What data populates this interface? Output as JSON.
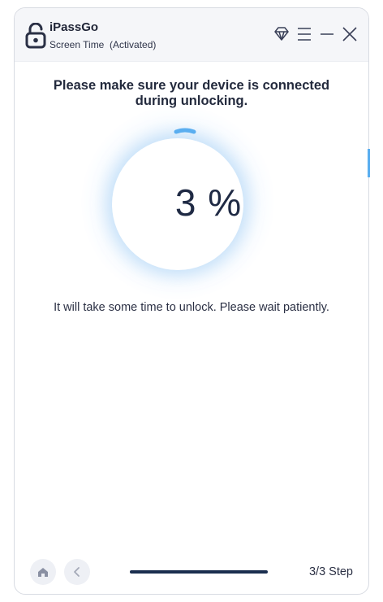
{
  "app": {
    "name": "iPassGo",
    "subtitle": "Screen Time  (Activated)"
  },
  "window_controls": {
    "icons": [
      "diamond-icon",
      "menu-icon",
      "minimize-icon",
      "close-icon"
    ]
  },
  "main": {
    "headline_line1": "Please make sure your device is connected",
    "headline_line2": "during unlocking.",
    "progress_text": "3 %",
    "progress_percent": 3,
    "hint": "It will take some time to unlock. Please wait patiently."
  },
  "footer": {
    "step_label": "3/3 Step",
    "icons": [
      "home-icon",
      "chevron-left-icon"
    ]
  },
  "colors": {
    "accent": "#5aaef0",
    "title_text": "#1f2436",
    "step_bar": "#1a2e4f"
  }
}
